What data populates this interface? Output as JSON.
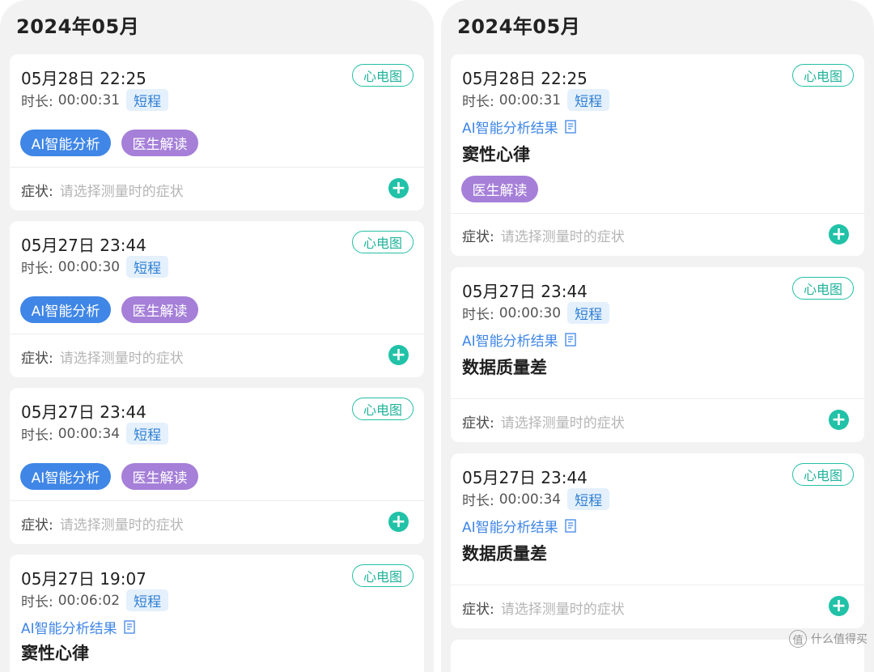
{
  "colors": {
    "teal_accent": "#21c2a7",
    "ai_blue": "#3f86e6",
    "doctor_purple": "#a57fd8",
    "short_chip_bg": "#e4f0fc",
    "panel_bg": "#f2f2f2"
  },
  "left_panel": {
    "month": "2024年05月",
    "records": [
      {
        "datetime": "05月28日  22:25",
        "duration_label": "时长:",
        "duration": "00:00:31",
        "type": "短程",
        "ecg": "心电图",
        "ai_button": "AI智能分析",
        "doctor_button": "医生解读",
        "symptom_label": "症状:",
        "symptom_placeholder": "请选择测量时的症状"
      },
      {
        "datetime": "05月27日  23:44",
        "duration_label": "时长:",
        "duration": "00:00:30",
        "type": "短程",
        "ecg": "心电图",
        "ai_button": "AI智能分析",
        "doctor_button": "医生解读",
        "symptom_label": "症状:",
        "symptom_placeholder": "请选择测量时的症状"
      },
      {
        "datetime": "05月27日  23:44",
        "duration_label": "时长:",
        "duration": "00:00:34",
        "type": "短程",
        "ecg": "心电图",
        "ai_button": "AI智能分析",
        "doctor_button": "医生解读",
        "symptom_label": "症状:",
        "symptom_placeholder": "请选择测量时的症状"
      },
      {
        "datetime": "05月27日  19:07",
        "duration_label": "时长:",
        "duration": "00:06:02",
        "type": "短程",
        "ecg": "心电图",
        "ai_result_label": "AI智能分析结果",
        "result": "窦性心律"
      }
    ]
  },
  "right_panel": {
    "month": "2024年05月",
    "records": [
      {
        "datetime": "05月28日  22:25",
        "duration_label": "时长:",
        "duration": "00:00:31",
        "type": "短程",
        "ecg": "心电图",
        "ai_result_label": "AI智能分析结果",
        "result": "窦性心律",
        "doctor_button": "医生解读",
        "symptom_label": "症状:",
        "symptom_placeholder": "请选择测量时的症状"
      },
      {
        "datetime": "05月27日  23:44",
        "duration_label": "时长:",
        "duration": "00:00:30",
        "type": "短程",
        "ecg": "心电图",
        "ai_result_label": "AI智能分析结果",
        "result": "数据质量差",
        "symptom_label": "症状:",
        "symptom_placeholder": "请选择测量时的症状"
      },
      {
        "datetime": "05月27日  23:44",
        "duration_label": "时长:",
        "duration": "00:00:34",
        "type": "短程",
        "ecg": "心电图",
        "ai_result_label": "AI智能分析结果",
        "result": "数据质量差",
        "symptom_label": "症状:",
        "symptom_placeholder": "请选择测量时的症状"
      }
    ]
  },
  "watermark": {
    "badge": "值",
    "text": "什么值得买"
  }
}
